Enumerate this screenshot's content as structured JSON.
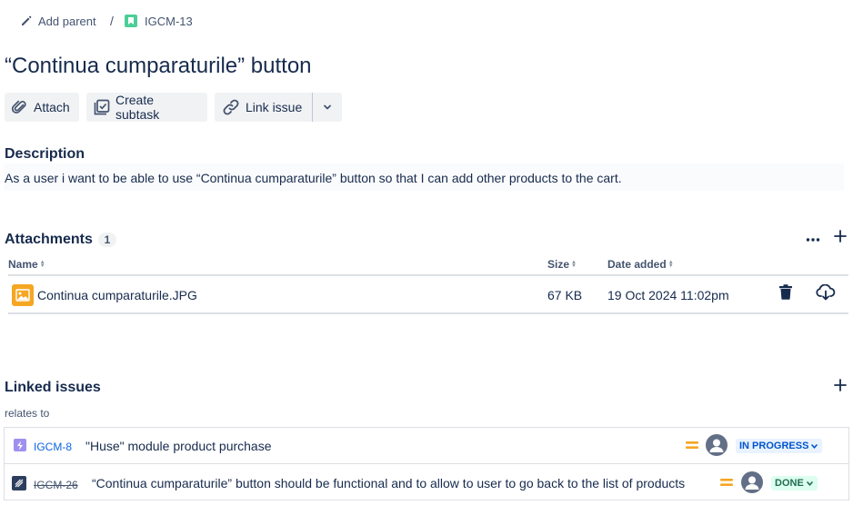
{
  "breadcrumb": {
    "add_parent": "Add parent",
    "separator": "/",
    "issue_key": "IGCM-13"
  },
  "issue": {
    "title": "“Continua cumparaturile” button"
  },
  "toolbar": {
    "attach": "Attach",
    "create_subtask": "Create subtask",
    "link_issue": "Link issue"
  },
  "description": {
    "heading": "Description",
    "text": "As a user i want to be able to use  “Continua cumparaturile” button so that I can add other products to the cart."
  },
  "attachments": {
    "heading": "Attachments",
    "count": "1",
    "columns": {
      "name": "Name",
      "size": "Size",
      "date": "Date added"
    },
    "rows": [
      {
        "name": "Continua cumparaturile.JPG",
        "size": "67 KB",
        "date": "19 Oct 2024 11:02pm"
      }
    ]
  },
  "linked": {
    "heading": "Linked issues",
    "relation": "relates to",
    "items": [
      {
        "key": "IGCM-8",
        "summary": "\"Huse\" module product purchase",
        "status": "IN PROGRESS",
        "type": "epic"
      },
      {
        "key": "IGCM-26",
        "summary": "“Continua cumparaturile” button should be functional and to allow to user to go back to the list of products",
        "status": "DONE",
        "type": "test"
      }
    ]
  },
  "colors": {
    "accent": "#0c66e4",
    "story": "#4bce97",
    "epic": "#9f8fef",
    "priority_medium": "#f5a623",
    "in_progress_bg": "#e9f2ff",
    "done_bg": "#dcfff1"
  }
}
